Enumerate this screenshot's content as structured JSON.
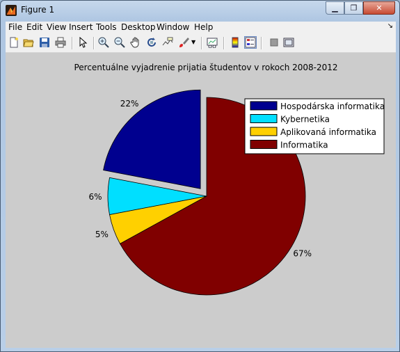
{
  "window": {
    "title": "Figure 1"
  },
  "menu": [
    "File",
    "Edit",
    "View",
    "Insert",
    "Tools",
    "Desktop",
    "Window",
    "Help"
  ],
  "toolbar_icons": [
    "new-figure-icon",
    "open-file-icon",
    "save-icon",
    "print-icon",
    "pointer-icon",
    "zoom-in-icon",
    "zoom-out-icon",
    "pan-icon",
    "rotate-3d-icon",
    "data-cursor-icon",
    "brush-icon",
    "link-plot-icon",
    "colorbar-icon",
    "legend-icon",
    "hide-plot-tools-icon",
    "show-plot-tools-icon"
  ],
  "colors": {
    "hospodarska": "#00008f",
    "kybernetika": "#00dfff",
    "aplikovana": "#ffd000",
    "informatika": "#800000",
    "axes_bg": "#cccccc"
  },
  "chart_data": {
    "type": "pie",
    "title": "Percentuálne vyjadrenie prijatia študentov v rokoch 2008-2012",
    "slices": [
      {
        "label": "Hospodárska informatika",
        "percent_label": "22%",
        "value": 22,
        "color": "#00008f",
        "exploded": true
      },
      {
        "label": "Kybernetika",
        "percent_label": "6%",
        "value": 6,
        "color": "#00dfff",
        "exploded": false
      },
      {
        "label": "Aplikovaná informatika",
        "percent_label": "5%",
        "value": 5,
        "color": "#ffd000",
        "exploded": false
      },
      {
        "label": "Informatika",
        "percent_label": "67%",
        "value": 67,
        "color": "#800000",
        "exploded": false
      }
    ],
    "legend_position": "top-right"
  }
}
